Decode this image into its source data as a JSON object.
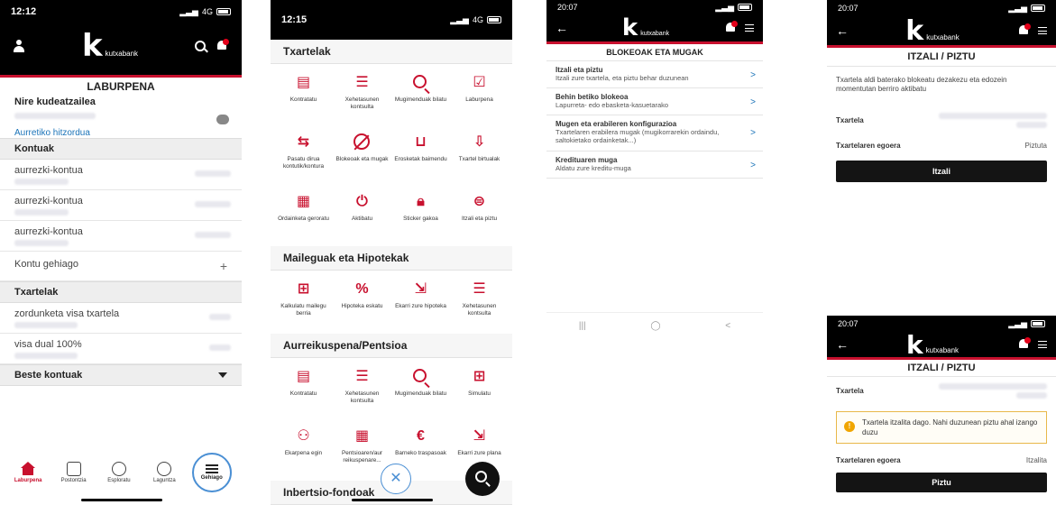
{
  "brand": {
    "name": "kutxabank",
    "letter": "k",
    "accent": "#c8102e",
    "link": "#1a73b8"
  },
  "phone1": {
    "time": "12:12",
    "net": "4G",
    "section_title": "LABURPENA",
    "manager_label": "Nire kudeatzailea",
    "appointment_link": "Aurretiko hitzordua",
    "accounts_header": "Kontuak",
    "accounts": [
      {
        "name": "aurrezki-kontua"
      },
      {
        "name": "aurrezki-kontua"
      },
      {
        "name": "aurrezki-kontua"
      }
    ],
    "more_accounts": "Kontu gehiago",
    "cards_header": "Txartelak",
    "cards": [
      {
        "name": "zordunketa visa txartela"
      },
      {
        "name": "visa dual 100%"
      }
    ],
    "other_accounts": "Beste kontuak",
    "tabs": [
      "Laburpena",
      "Postontzia",
      "Esploratu",
      "Laguntza",
      "Gehiago"
    ]
  },
  "phone2": {
    "time": "12:15",
    "net": "4G",
    "categories": [
      {
        "title": "Txartelak",
        "items": [
          {
            "label": "Kontratatu",
            "icon": "contract-icon"
          },
          {
            "label": "Xehetasunen kontsulta",
            "icon": "list-icon"
          },
          {
            "label": "Mugimenduak bilatu",
            "icon": "search-icon"
          },
          {
            "label": "Laburpena",
            "icon": "summary-icon"
          },
          {
            "label": "Pasatu dirua kontutik/kontura",
            "icon": "transfer-icon"
          },
          {
            "label": "Blokeoak eta mugak",
            "icon": "block-icon"
          },
          {
            "label": "Erosketak baimendu",
            "icon": "cart-icon"
          },
          {
            "label": "Txartel birtualak",
            "icon": "virtual-card-icon"
          },
          {
            "label": "Ordainketa geroratu",
            "icon": "calendar-icon"
          },
          {
            "label": "Aktibatu",
            "icon": "power-icon"
          },
          {
            "label": "Sticker gakoa",
            "icon": "lock-icon"
          },
          {
            "label": "Itzali eta piztu",
            "icon": "toggle-icon"
          }
        ]
      },
      {
        "title": "Maileguak eta Hipotekak",
        "items": [
          {
            "label": "Kalkulatu mailegu berria",
            "icon": "calculator-icon"
          },
          {
            "label": "Hipoteka eskatu",
            "icon": "house-percent-icon"
          },
          {
            "label": "Ekarri zure hipoteka",
            "icon": "import-icon"
          },
          {
            "label": "Xehetasunen kontsulta",
            "icon": "list-icon"
          }
        ]
      },
      {
        "title": "Aurreikuspena/Pentsioa",
        "items": [
          {
            "label": "Kontratatu",
            "icon": "contract-icon"
          },
          {
            "label": "Xehetasunen kontsulta",
            "icon": "list-icon"
          },
          {
            "label": "Mugimenduak bilatu",
            "icon": "search-icon"
          },
          {
            "label": "Simulatu",
            "icon": "calculator-icon"
          },
          {
            "label": "Ekarpena egin",
            "icon": "piggy-icon"
          },
          {
            "label": "Pentsioaren/aur reikuspenare...",
            "icon": "calendar-icon"
          },
          {
            "label": "Barneko traspasoak",
            "icon": "euro-icon"
          },
          {
            "label": "Ekarri zure plana",
            "icon": "import-icon"
          }
        ]
      },
      {
        "title": "Inbertsio-fondoak",
        "items": []
      }
    ]
  },
  "phone3": {
    "time": "20:07",
    "title": "BLOKEOAK ETA MUGAK",
    "items": [
      {
        "title": "Itzali eta piztu",
        "sub": "Itzali zure txartela, eta piztu behar duzunean"
      },
      {
        "title": "Behin betiko blokeoa",
        "sub": "Lapurreta- edo ebasketa-kasuetarako"
      },
      {
        "title": "Mugen eta erabileren konfigurazioa",
        "sub": "Txartelaren erabilera mugak (mugikorrarekin ordaindu, saltokietako ordainketak...)"
      },
      {
        "title": "Kredituaren muga",
        "sub": "Aldatu zure kreditu-muga"
      }
    ]
  },
  "phone4": {
    "time": "20:07",
    "title": "ITZALI / PIZTU",
    "description": "Txartela aldi baterako blokeatu dezakezu eta edozein momentutan berriro aktibatu",
    "card_label": "Txartela",
    "status_label": "Txartelaren egoera",
    "status_value": "Piztuta",
    "button": "Itzali"
  },
  "phone5": {
    "time": "20:07",
    "title": "ITZALI / PIZTU",
    "card_label": "Txartela",
    "alert": "Txartela itzalita dago. Nahi duzunean piztu ahal izango duzu",
    "status_label": "Txartelaren egoera",
    "status_value": "Itzalita",
    "button": "Piztu"
  }
}
